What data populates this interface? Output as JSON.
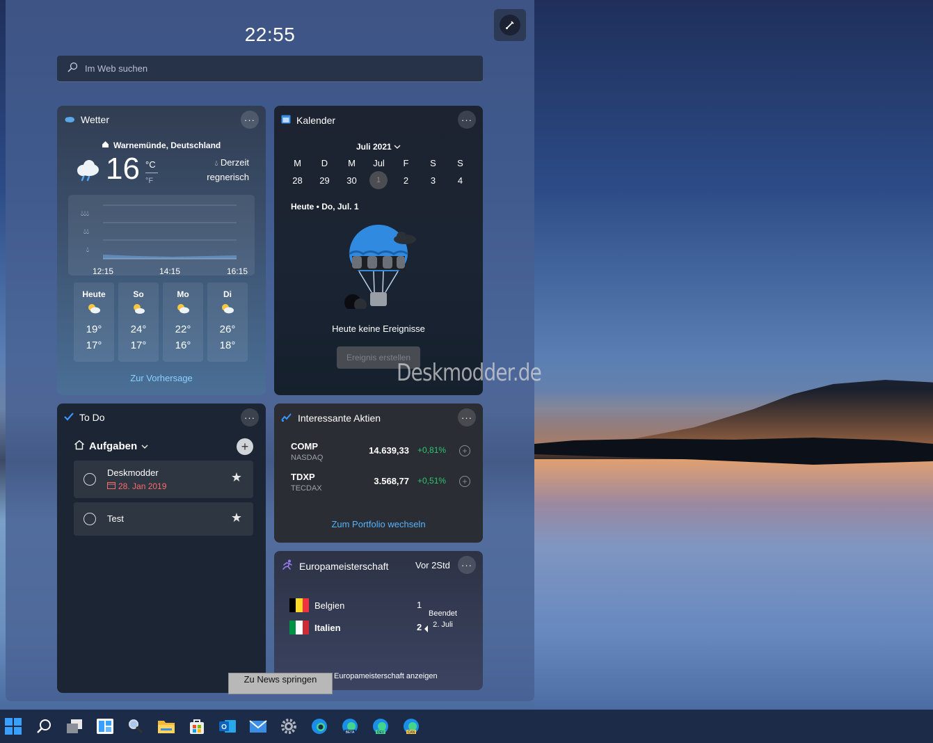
{
  "clock": "22:55",
  "search": {
    "placeholder": "Im Web suchen"
  },
  "weather": {
    "title": "Wetter",
    "location": "Warnemünde, Deutschland",
    "temp": "16",
    "unit_c": "°C",
    "unit_f": "°F",
    "condition_line1": "Derzeit",
    "condition_line2": "regnerisch",
    "chart_times": [
      "12:15",
      "14:15",
      "16:15"
    ],
    "days": [
      {
        "name": "Heute",
        "hi": "19°",
        "lo": "17°"
      },
      {
        "name": "So",
        "hi": "24°",
        "lo": "17°"
      },
      {
        "name": "Mo",
        "hi": "22°",
        "lo": "16°"
      },
      {
        "name": "Di",
        "hi": "26°",
        "lo": "18°"
      }
    ],
    "link": "Zur Vorhersage"
  },
  "calendar": {
    "title": "Kalender",
    "month": "Juli 2021",
    "weekdays": [
      "M",
      "D",
      "M",
      "Jul",
      "F",
      "S",
      "S"
    ],
    "dates": [
      "28",
      "29",
      "30",
      "1",
      "2",
      "3",
      "4"
    ],
    "today_label": "Heute • Do, Jul. 1",
    "empty": "Heute keine Ereignisse",
    "button": "Ereignis erstellen"
  },
  "watermark": "Deskmodder.de",
  "todo": {
    "title": "To Do",
    "list": "Aufgaben",
    "tasks": [
      {
        "title": "Deskmodder",
        "date": "28. Jan 2019"
      },
      {
        "title": "Test"
      }
    ]
  },
  "stocks": {
    "title": "Interessante Aktien",
    "items": [
      {
        "symbol": "COMP",
        "exchange": "NASDAQ",
        "value": "14.639,33",
        "change": "+0,81%"
      },
      {
        "symbol": "TDXP",
        "exchange": "TECDAX",
        "value": "3.568,77",
        "change": "+0,51%"
      }
    ],
    "link": "Zum Portfolio wechseln"
  },
  "euro": {
    "title": "Europameisterschaft",
    "time": "Vor 2Std",
    "team1": "Belgien",
    "score1": "1",
    "team2": "Italien",
    "score2": "2",
    "status1": "Beendet",
    "status2": "2. Juli",
    "link": "Europameisterschaft anzeigen"
  },
  "news_button": "Zu News springen",
  "colors": {
    "accent": "#55b4ff",
    "positive": "#2ec66e",
    "due": "#ff6b6b"
  }
}
